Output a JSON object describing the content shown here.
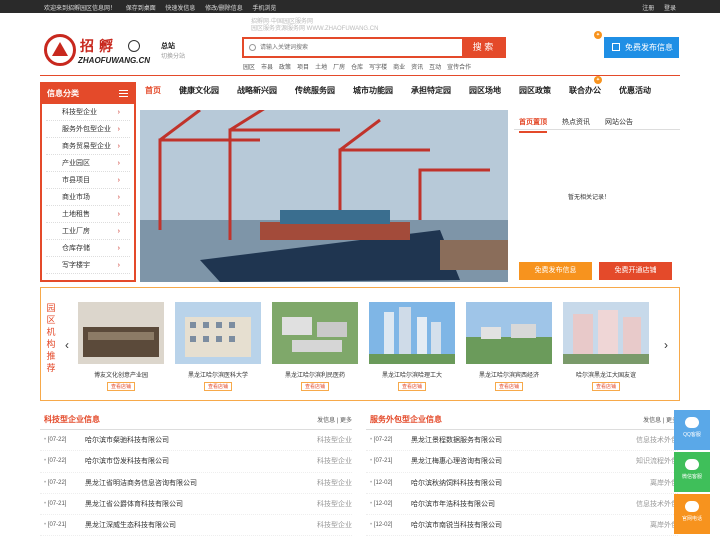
{
  "topbar": {
    "links": [
      "欢迎来到招孵园区信息网！",
      "保存到桌面",
      "快速发信息",
      "修改/删除信息",
      "手机浏览"
    ],
    "login": "注册",
    "register": "登录"
  },
  "header": {
    "logo_cn": "招孵",
    "logo_en": "ZHAOFUWANG.CN",
    "station": "总站",
    "station_sub": "切换分站",
    "slogan1": "招孵网·中国园区服务网",
    "slogan2": "园区服务资源服务网 WWW.ZHAOFUWANG.CN",
    "search_placeholder": "请输入关键词搜索",
    "search_button": "搜 索",
    "quick": [
      "园区",
      "市县",
      "政策",
      "项目",
      "土地",
      "厂房",
      "仓库",
      "写字楼",
      "商业",
      "资讯",
      "互动",
      "宣传合作"
    ],
    "publish": "免费发布信息"
  },
  "nav": [
    "首页",
    "健康文化园",
    "战略新兴园",
    "传统服务园",
    "城市功能园",
    "承担特定园",
    "园区场地",
    "园区政策",
    "联合办公",
    "优惠活动"
  ],
  "categories": {
    "title": "信息分类",
    "items": [
      "科技型企业",
      "服务外包型企业",
      "商务贸易型企业",
      "产业园区",
      "市县项目",
      "商业市场",
      "土地租售",
      "工业厂房",
      "仓库存储",
      "写字楼宇"
    ]
  },
  "news": {
    "tabs": [
      "首页置顶",
      "热点资讯",
      "网站公告"
    ],
    "empty": "暂无相关记录！",
    "btn1": "免费发布信息",
    "btn2": "免费开通店铺"
  },
  "orgs": {
    "title": "园区机构推荐",
    "view_label": "查看店铺",
    "items": [
      "博友文化创意产业园",
      "黑龙江哈尔滨医科大学",
      "黑龙江哈尔滨利民医药",
      "黑龙江哈尔滨哈理工大",
      "黑龙江哈尔滨宾西经济",
      "哈尔滨黑龙江大国友谊"
    ]
  },
  "sec1": {
    "title": "科技型企业信息",
    "more": "发信息 | 更多",
    "rows": [
      {
        "d": "[07-22]",
        "n": "哈尔滨市粲驰科技有限公司",
        "c": "科技型企业"
      },
      {
        "d": "[07-22]",
        "n": "哈尔滨市岱发科技有限公司",
        "c": "科技型企业"
      },
      {
        "d": "[07-22]",
        "n": "黑龙江省明洁商务信息咨询有限公司",
        "c": "科技型企业"
      },
      {
        "d": "[07-21]",
        "n": "黑龙江省公爵体育科技有限公司",
        "c": "科技型企业"
      },
      {
        "d": "[07-21]",
        "n": "黑龙江深威生态科技有限公司",
        "c": "科技型企业"
      }
    ]
  },
  "sec2": {
    "title": "服务外包型企业信息",
    "more": "发信息 | 更多",
    "rows": [
      {
        "d": "[07-22]",
        "n": "黑龙江景程数据服务有限公司",
        "c": "信息技术外包"
      },
      {
        "d": "[07-21]",
        "n": "黑龙江梅惠心理咨询有限公司",
        "c": "知识流程外包"
      },
      {
        "d": "[12-02]",
        "n": "哈尔滨秋纳饲料科技有限公司",
        "c": "离岸外包"
      },
      {
        "d": "[12-02]",
        "n": "哈尔滨市年浩科技有限公司",
        "c": "信息技术外包"
      },
      {
        "d": "[12-02]",
        "n": "哈尔滨市南锐当科技有限公司",
        "c": "离岸外包"
      }
    ]
  },
  "side": [
    "QQ客服",
    "微信客服",
    "官网电话"
  ],
  "colors": {
    "brand": "#e44a2a",
    "blue": "#1f8fe5",
    "orange": "#f7931e"
  }
}
